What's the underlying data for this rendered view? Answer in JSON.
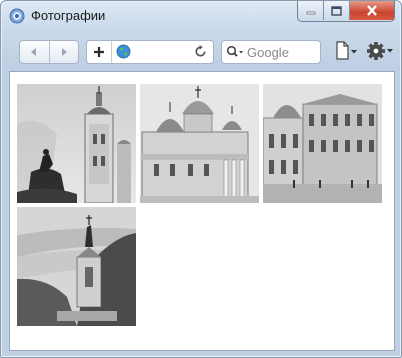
{
  "window": {
    "title": "Фотографии"
  },
  "toolbar": {
    "search_placeholder": "Google"
  },
  "colors": {
    "close_button": "#c9452e",
    "frame": "#bfd0e4",
    "page_background": "#ffffff"
  },
  "icons": {
    "back": "left-arrow-icon",
    "forward": "right-arrow-icon",
    "add": "plus-icon",
    "site": "globe-icon",
    "reload": "reload-icon",
    "search": "magnifier-icon",
    "page_menu": "page-icon",
    "tools_menu": "gear-icon"
  },
  "photos": [
    {
      "subject": "bell-tower-monument"
    },
    {
      "subject": "domed-church"
    },
    {
      "subject": "palace-building"
    },
    {
      "subject": "riverside-monument"
    }
  ]
}
